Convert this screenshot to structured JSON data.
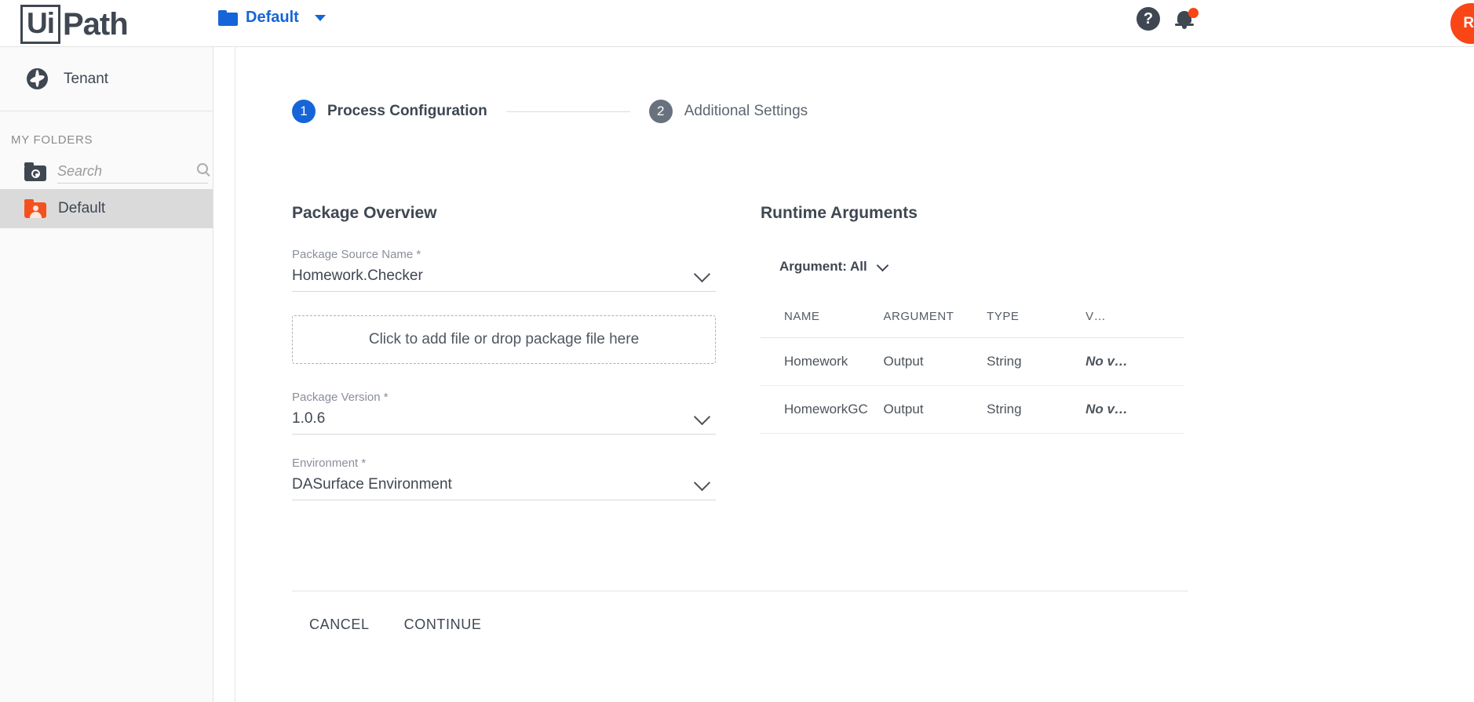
{
  "brand": {
    "logo_ui": "Ui",
    "logo_path": "Path",
    "accent_blue": "#1565d8",
    "accent_orange": "#fa4616",
    "folder_orange": "#f4511e"
  },
  "topbar": {
    "folder_switch_label": "Default",
    "folder_icon": "folder-icon",
    "caret_icon": "caret-down-icon",
    "help_icon": "help-icon",
    "help_glyph": "?",
    "notifications_icon": "bell-icon",
    "notification_badge": "",
    "avatar_initials": "RF"
  },
  "sidebar": {
    "tenant": {
      "label": "Tenant",
      "icon": "globe-icon"
    },
    "section_label": "MY FOLDERS",
    "search": {
      "placeholder": "Search",
      "value": "",
      "icon": "folder-target-icon",
      "search_icon": "search-icon"
    },
    "folders": [
      {
        "label": "Default",
        "icon": "folder-person-icon",
        "selected": true
      }
    ]
  },
  "stepper": {
    "steps": [
      {
        "number": "1",
        "label": "Process Configuration",
        "active": true
      },
      {
        "number": "2",
        "label": "Additional Settings",
        "active": false
      }
    ]
  },
  "package_overview": {
    "title": "Package Overview",
    "fields": [
      {
        "label": "Package Source Name *",
        "value": "Homework.Checker",
        "icon": "chevron-down-icon"
      },
      {
        "label": "Package Version *",
        "value": "1.0.6",
        "icon": "chevron-down-icon"
      },
      {
        "label": "Environment *",
        "value": "DASurface Environment",
        "icon": "chevron-down-icon"
      }
    ],
    "dropzone_text": "Click to add file or drop package file here"
  },
  "runtime_arguments": {
    "title": "Runtime Arguments",
    "filter_label": "Argument: All",
    "filter_icon": "chevron-down-icon",
    "columns": [
      "NAME",
      "ARGUMENT",
      "TYPE",
      "V…"
    ],
    "rows": [
      {
        "name": "Homework",
        "argument": "Output",
        "type": "String",
        "value": "No v…"
      },
      {
        "name": "HomeworkGC",
        "argument": "Output",
        "type": "String",
        "value": "No v…"
      }
    ]
  },
  "footer": {
    "cancel_label": "CANCEL",
    "continue_label": "CONTINUE"
  }
}
